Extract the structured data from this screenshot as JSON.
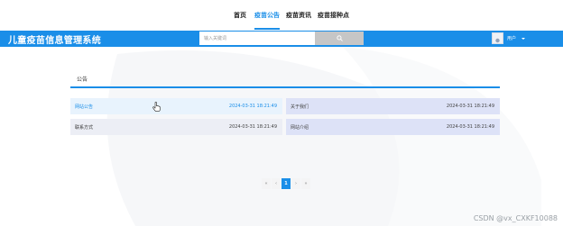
{
  "top_nav": {
    "items": [
      {
        "label": "首页"
      },
      {
        "label": "疫苗公告"
      },
      {
        "label": "疫苗资讯"
      },
      {
        "label": "疫苗接种点"
      }
    ]
  },
  "header": {
    "site_title": "儿童疫苗信息管理系统",
    "search": {
      "placeholder": "输入关键词",
      "button_icon": "search-icon"
    },
    "user": {
      "label": "用户",
      "avatar_icon": "user-avatar-icon",
      "menu_icon": "caret-down-icon"
    }
  },
  "colors": {
    "accent": "#1a8ee8",
    "hover_row": "#e8f3fd",
    "row_gray": "#eceef5",
    "row_tint": "#dde2f7"
  },
  "notice_section": {
    "title": "公告",
    "items": [
      {
        "title": "网站公告",
        "date": "2024-03-31 18:21:49"
      },
      {
        "title": "关于我们",
        "date": "2024-03-31 18:21:49"
      },
      {
        "title": "联系方式",
        "date": "2024-03-31 18:21:49"
      },
      {
        "title": "网站介绍",
        "date": "2024-03-31 18:21:49"
      }
    ]
  },
  "pagination": {
    "first": "«",
    "prev": "‹",
    "current_page": "1",
    "next": "›",
    "last": "»"
  },
  "watermark": "CSDN @vx_CXKF10088"
}
